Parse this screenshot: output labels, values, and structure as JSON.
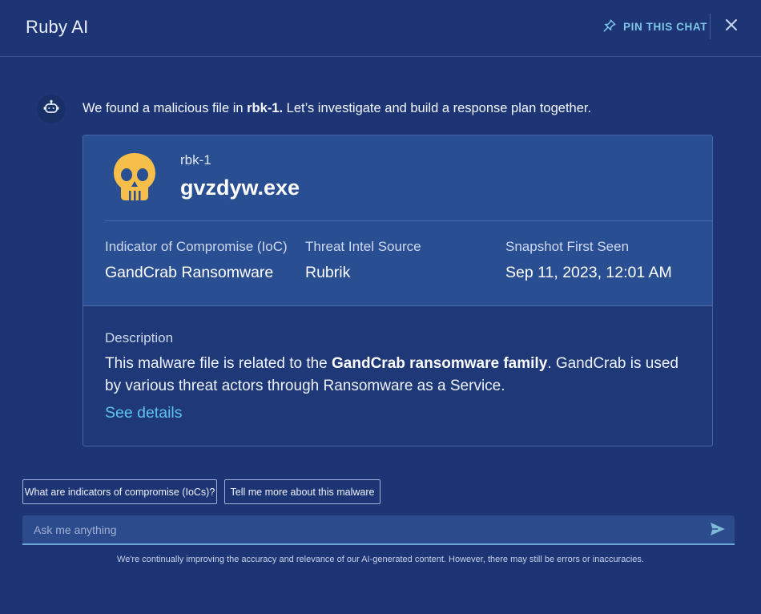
{
  "header": {
    "title": "Ruby AI",
    "pin_label": "PIN THIS CHAT",
    "pin_icon": "pin-icon",
    "close_icon": "close-icon"
  },
  "message": {
    "avatar_icon": "bot-icon",
    "text_prefix": "We found a malicious file in ",
    "text_bold": "rbk-1.",
    "text_suffix": " Let’s investigate and build a response plan together."
  },
  "card": {
    "icon": "skull-icon",
    "host": "rbk-1",
    "file_name": "gvzdyw.exe",
    "fields": [
      {
        "label": "Indicator of Compromise (IoC)",
        "value": "GandCrab Ransomware"
      },
      {
        "label": "Threat Intel Source",
        "value": "Rubrik"
      },
      {
        "label": "Snapshot First Seen",
        "value": "Sep 11, 2023, 12:01 AM"
      }
    ],
    "description_label": "Description",
    "description_prefix": "This malware file is related to the ",
    "description_bold": "GandCrab ransomware family",
    "description_suffix": ". GandCrab is used by various threat actors through Ransomware as a  Service.",
    "see_details": "See details"
  },
  "suggestions": [
    "What are indicators of compromise (IoCs)?",
    "Tell me more about this malware"
  ],
  "input": {
    "placeholder": "Ask me anything",
    "send_icon": "send-icon"
  },
  "disclaimer": "We're continually improving the accuracy and relevance of our AI-generated content. However, there may still be errors or inaccuracies.",
  "colors": {
    "background": "#1d3574",
    "accent": "#5fc3ee",
    "skull": "#f5bf4a"
  }
}
